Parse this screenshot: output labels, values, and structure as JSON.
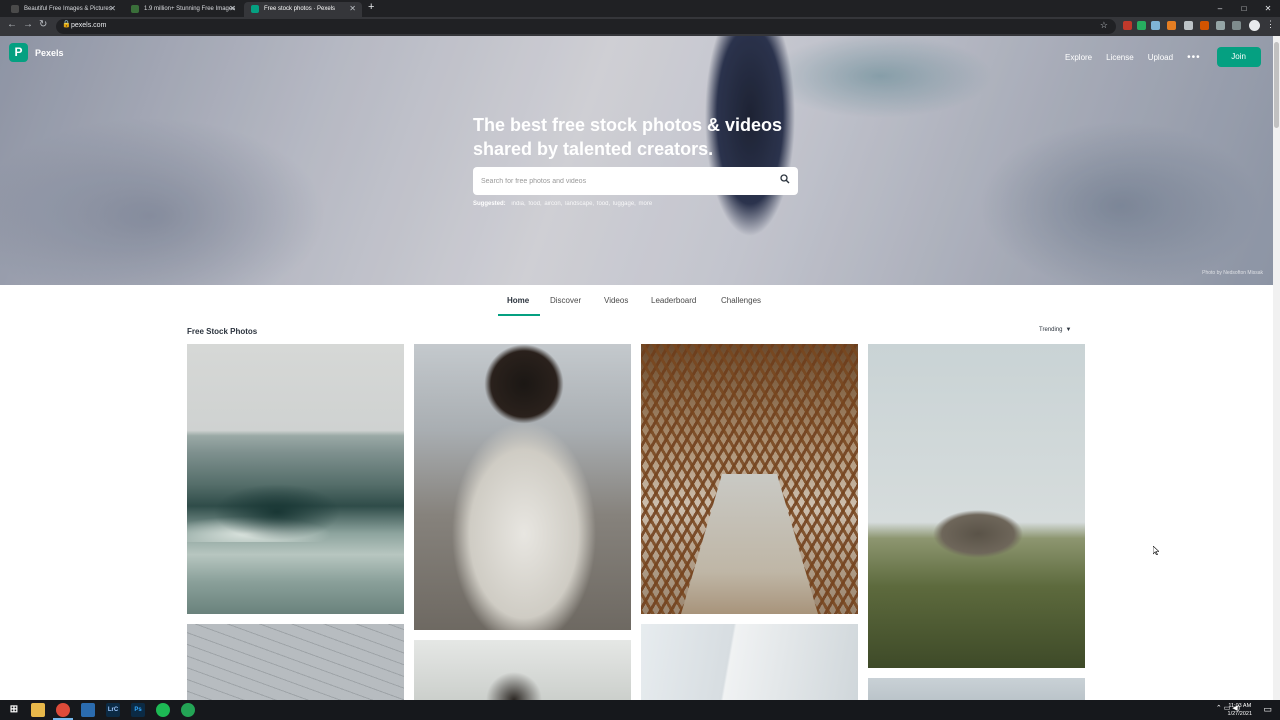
{
  "browser": {
    "tabs": [
      {
        "title": "Beautiful Free Images & Pictures",
        "favicon_color": "#4a4a4a"
      },
      {
        "title": "1.9 million+ Stunning Free Images",
        "favicon_color": "#3a6f3a"
      },
      {
        "title": "Free stock photos · Pexels",
        "favicon_color": "#05a081"
      }
    ],
    "new_tab": "+",
    "url": "pexels.com",
    "window_controls": [
      "–",
      "□",
      "✕"
    ]
  },
  "site": {
    "brand": "Pexels",
    "brand_color": "#05a081",
    "nav": [
      "Explore",
      "License",
      "Upload"
    ],
    "more": "•••",
    "join": "Join"
  },
  "hero": {
    "headline_line1": "The best free stock photos & videos",
    "headline_line2": "shared by talented creators.",
    "search_placeholder": "Search for free photos and videos",
    "suggested_label": "Suggested:",
    "suggested": [
      "india,",
      "food,",
      "aircon,",
      "landscape,",
      "food,",
      "luggage,",
      "more"
    ],
    "credit": "Photo by Nedsofton Missak"
  },
  "tabs": [
    {
      "label": "Home",
      "active": true
    },
    {
      "label": "Discover",
      "active": false
    },
    {
      "label": "Videos",
      "active": false
    },
    {
      "label": "Leaderboard",
      "active": false
    },
    {
      "label": "Challenges",
      "active": false
    }
  ],
  "feed": {
    "title": "Free Stock Photos",
    "sort": "Trending"
  },
  "taskbar": {
    "apps": [
      {
        "name": "file-explorer",
        "label": "",
        "color": "#e8b84a"
      },
      {
        "name": "chrome",
        "label": "",
        "color": "#dd4b39"
      },
      {
        "name": "mail",
        "label": "",
        "color": "#2b6cb0"
      },
      {
        "name": "lightroom",
        "label": "LrC",
        "color": "#0b2a44"
      },
      {
        "name": "photoshop",
        "label": "Ps",
        "color": "#0b2a44"
      },
      {
        "name": "spotify",
        "label": "",
        "color": "#1db954"
      },
      {
        "name": "terminal",
        "label": "",
        "color": "#23a455"
      }
    ],
    "time": "11:03 AM",
    "date": "1/27/2021"
  }
}
